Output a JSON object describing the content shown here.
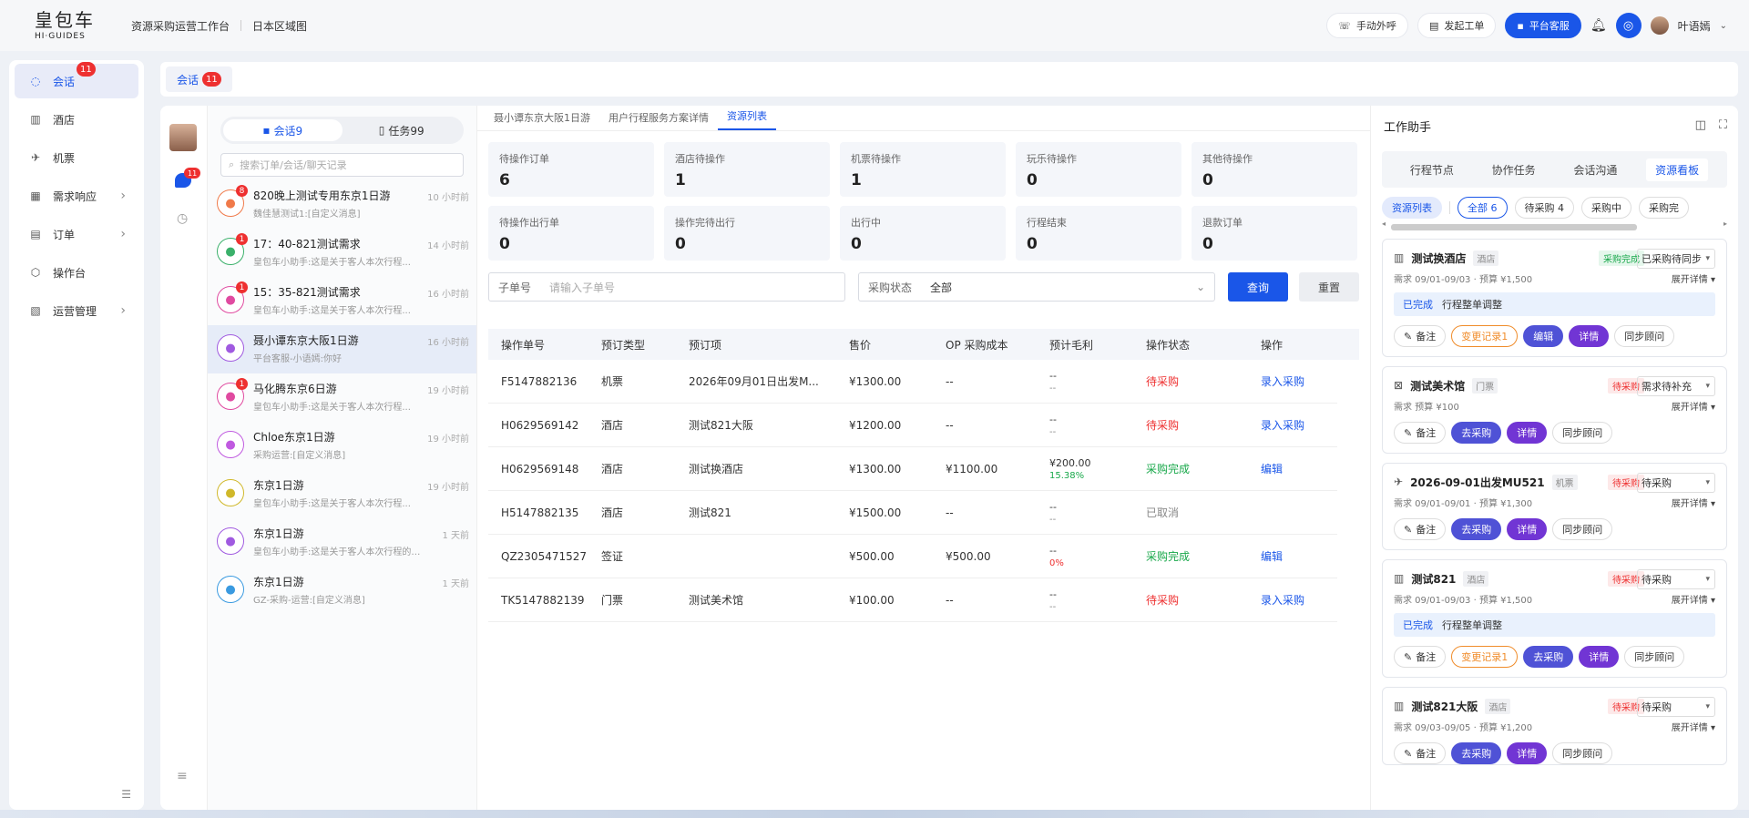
{
  "brand": {
    "logo_main": "皇包车",
    "logo_sub": "HI·GUIDES"
  },
  "topnav": [
    "资源采购运营工作台",
    "日本区域图"
  ],
  "topright": {
    "manual_call": "手动外呼",
    "create_ticket": "发起工单",
    "platform_service": "平台客服",
    "user_name": "叶语嫣"
  },
  "sidebar": {
    "items": [
      {
        "label": "会话",
        "badge": "11"
      },
      {
        "label": "酒店"
      },
      {
        "label": "机票"
      },
      {
        "label": "需求响应"
      },
      {
        "label": "订单"
      },
      {
        "label": "操作台"
      },
      {
        "label": "运营管理"
      }
    ]
  },
  "tabs": [
    {
      "label": "会话",
      "badge": "11"
    }
  ],
  "iconcol": {
    "chat_badge": "11"
  },
  "conv": {
    "seg_chat": "会话9",
    "seg_task": "任务99",
    "search_placeholder": "搜索订单/会话/聊天记录",
    "items": [
      {
        "title": "820晚上测试专用东京1日游",
        "sub": "魏佳慧测试1:[自定义消息]",
        "time": "10 小时前",
        "badge": "8"
      },
      {
        "title": "17：40-821测试需求",
        "sub": "皇包车小助手:这是关于客人本次行程...",
        "time": "14 小时前",
        "badge": "1"
      },
      {
        "title": "15：35-821测试需求",
        "sub": "皇包车小助手:这是关于客人本次行程...",
        "time": "16 小时前",
        "badge": "1"
      },
      {
        "title": "聂小谭东京大阪1日游",
        "sub": "平台客服-小语嫣:你好",
        "time": "16 小时前",
        "badge": ""
      },
      {
        "title": "马化腾东京6日游",
        "sub": "皇包车小助手:这是关于客人本次行程...",
        "time": "19 小时前",
        "badge": "1"
      },
      {
        "title": "Chloe东京1日游",
        "sub": "采购运营:[自定义消息]",
        "time": "19 小时前",
        "badge": ""
      },
      {
        "title": "东京1日游",
        "sub": "皇包车小助手:这是关于客人本次行程...",
        "time": "19 小时前",
        "badge": ""
      },
      {
        "title": "东京1日游",
        "sub": "皇包车小助手:这是关于客人本次行程的协...",
        "time": "1 天前",
        "badge": ""
      },
      {
        "title": "东京1日游",
        "sub": "GZ-采购-运营:[自定义消息]",
        "time": "1 天前",
        "badge": ""
      }
    ]
  },
  "center": {
    "subtabs": [
      "聂小谭东京大阪1日游",
      "用户行程服务方案详情",
      "资源列表"
    ],
    "stats": [
      {
        "label": "待操作订单",
        "value": "6"
      },
      {
        "label": "酒店待操作",
        "value": "1"
      },
      {
        "label": "机票待操作",
        "value": "1"
      },
      {
        "label": "玩乐待操作",
        "value": "0"
      },
      {
        "label": "其他待操作",
        "value": "0"
      },
      {
        "label": "待操作出行单",
        "value": "0"
      },
      {
        "label": "操作完待出行",
        "value": "0"
      },
      {
        "label": "出行中",
        "value": "0"
      },
      {
        "label": "行程结束",
        "value": "0"
      },
      {
        "label": "退款订单",
        "value": "0"
      }
    ],
    "filter": {
      "sub_no_label": "子单号",
      "sub_no_placeholder": "请输入子单号",
      "status_label": "采购状态",
      "status_value": "全部",
      "query": "查询",
      "reset": "重置"
    },
    "table": {
      "headers": [
        "操作单号",
        "预订类型",
        "预订项",
        "售价",
        "OP 采购成本",
        "预计毛利",
        "操作状态",
        "操作"
      ],
      "rows": [
        {
          "no": "F5147882136",
          "type": "机票",
          "item": "2026年09月01日出发M...",
          "price": "¥1300.00",
          "cost": "--",
          "margin_a": "--",
          "margin_b": "--",
          "status": "待采购",
          "action": "录入采购"
        },
        {
          "no": "H0629569142",
          "type": "酒店",
          "item": "测试821大阪",
          "price": "¥1200.00",
          "cost": "--",
          "margin_a": "--",
          "margin_b": "--",
          "status": "待采购",
          "action": "录入采购"
        },
        {
          "no": "H0629569148",
          "type": "酒店",
          "item": "测试换酒店",
          "price": "¥1300.00",
          "cost": "¥1100.00",
          "margin_a": "¥200.00",
          "margin_b": "15.38%",
          "status": "采购完成",
          "action": "编辑"
        },
        {
          "no": "H5147882135",
          "type": "酒店",
          "item": "测试821",
          "price": "¥1500.00",
          "cost": "--",
          "margin_a": "--",
          "margin_b": "--",
          "status": "已取消",
          "action": ""
        },
        {
          "no": "QZ2305471527",
          "type": "签证",
          "item": "",
          "price": "¥500.00",
          "cost": "¥500.00",
          "margin_a": "--",
          "margin_b": "0%",
          "status": "采购完成",
          "action": "编辑"
        },
        {
          "no": "TK5147882139",
          "type": "门票",
          "item": "测试美术馆",
          "price": "¥100.00",
          "cost": "--",
          "margin_a": "--",
          "margin_b": "--",
          "status": "待采购",
          "action": "录入采购"
        }
      ]
    }
  },
  "right": {
    "title": "工作助手",
    "tabs": [
      "行程节点",
      "协作任务",
      "会话沟通",
      "资源看板"
    ],
    "chips": [
      "资源列表",
      "全部 6",
      "待采购 4",
      "采购中",
      "采购完"
    ],
    "cards": [
      {
        "title": "测试换酒店",
        "tag": "酒店",
        "status": "采购完成",
        "select": "已采购待同步",
        "meta": "需求 09/01-09/03 · 预算 ¥1,500",
        "expand": "展开详情",
        "note_status": "已完成",
        "note_text": "行程整单调整",
        "actions": [
          "备注",
          "变更记录1",
          "编辑",
          "详情",
          "同步顾问"
        ]
      },
      {
        "title": "测试美术馆",
        "tag": "门票",
        "status": "待采购",
        "select": "需求待补充",
        "meta": "需求 预算 ¥100",
        "expand": "展开详情",
        "actions": [
          "备注",
          "去采购",
          "详情",
          "同步顾问"
        ]
      },
      {
        "title": "2026-09-01出发MU521",
        "tag": "机票",
        "status": "待采购",
        "select": "待采购",
        "meta": "需求 09/01-09/01 · 预算 ¥1,300",
        "expand": "展开详情",
        "actions": [
          "备注",
          "去采购",
          "详情",
          "同步顾问"
        ]
      },
      {
        "title": "测试821",
        "tag": "酒店",
        "status": "待采购",
        "select": "待采购",
        "meta": "需求 09/01-09/03 · 预算 ¥1,500",
        "expand": "展开详情",
        "note_status": "已完成",
        "note_text": "行程整单调整",
        "actions": [
          "备注",
          "变更记录1",
          "去采购",
          "详情",
          "同步顾问"
        ]
      },
      {
        "title": "测试821大阪",
        "tag": "酒店",
        "status": "待采购",
        "select": "待采购",
        "meta": "需求 09/03-09/05 · 预算 ¥1,200",
        "expand": "展开详情",
        "actions": [
          "备注",
          "去采购",
          "详情",
          "同步顾问"
        ]
      }
    ]
  }
}
